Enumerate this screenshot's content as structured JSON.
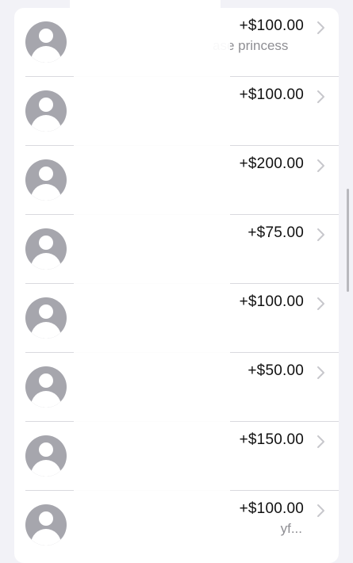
{
  "transactions": [
    {
      "amount": "+$100.00",
      "memo": "ase princess",
      "memo_right": ""
    },
    {
      "amount": "+$100.00",
      "memo": "",
      "memo_right": ""
    },
    {
      "amount": "+$200.00",
      "memo": "",
      "memo_right": ""
    },
    {
      "amount": "+$75.00",
      "memo": "",
      "memo_right": ""
    },
    {
      "amount": "+$100.00",
      "memo": "",
      "memo_right": ""
    },
    {
      "amount": "+$50.00",
      "memo": "",
      "memo_right": ""
    },
    {
      "amount": "+$150.00",
      "memo": "",
      "memo_right": ""
    },
    {
      "amount": "+$100.00",
      "memo": "",
      "memo_right": "yf..."
    }
  ],
  "icons": {
    "avatar": "person-placeholder-icon",
    "chevron": "chevron-right-icon"
  },
  "colors": {
    "avatar_bg": "#a6a6ad",
    "secondary_text": "#8e8e93",
    "chevron": "#c7c7cc"
  }
}
